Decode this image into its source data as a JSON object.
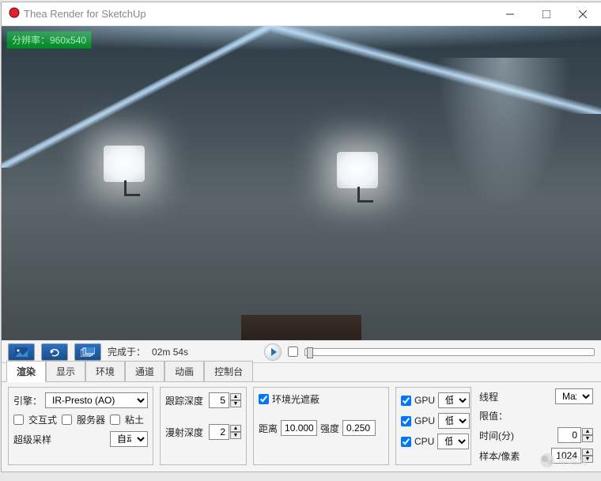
{
  "window": {
    "title": "Thea Render for SketchUp"
  },
  "viewport": {
    "resolution_label": "分辨率：960x540"
  },
  "toolbar": {
    "completed_label": "完成于：",
    "completed_time": "02m 54s"
  },
  "tabs": [
    "渲染",
    "显示",
    "环境",
    "通道",
    "动画",
    "控制台"
  ],
  "engine": {
    "label": "引擎：",
    "selected": "IR-Presto (AO)",
    "interactive_label": "交互式",
    "server_label": "服务器",
    "clay_label": "粘土",
    "supersampling_label": "超级采样",
    "supersampling_value": "自动"
  },
  "depth": {
    "trace_label": "跟踪深度",
    "trace_value": "5",
    "diffuse_label": "漫射深度",
    "diffuse_value": "2"
  },
  "ao": {
    "enable_label": "环境光遮蔽",
    "distance_label": "距离",
    "distance_value": "10.000",
    "intensity_label": "强度",
    "intensity_value": "0.250"
  },
  "devices": {
    "rows": [
      {
        "check": true,
        "label": "GPU",
        "level": "低"
      },
      {
        "check": true,
        "label": "GPU",
        "level": "低"
      },
      {
        "check": true,
        "label": "CPU",
        "level": "低"
      }
    ]
  },
  "limits": {
    "threads_label": "线程",
    "threads_value": "Max",
    "limit_label": "限值：",
    "time_label": "时间(分)",
    "time_value": "0",
    "samples_label": "样本/像素",
    "samples_value": "1024"
  },
  "watermark": "中略网"
}
